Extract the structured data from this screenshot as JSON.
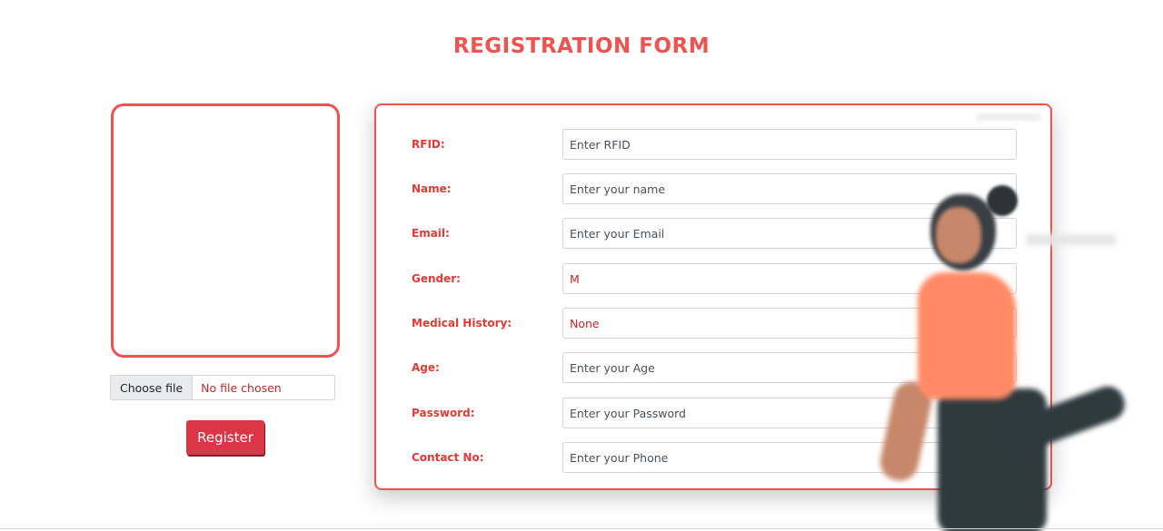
{
  "header": {
    "title": "REGISTRATION FORM"
  },
  "upload": {
    "choose_label": "Choose file",
    "status": "No file chosen"
  },
  "register_label": "Register",
  "form": {
    "rfid": {
      "label": "RFID:",
      "placeholder": "Enter RFID",
      "value": ""
    },
    "name": {
      "label": "Name:",
      "placeholder": "Enter your name",
      "value": ""
    },
    "email": {
      "label": "Email:",
      "placeholder": "Enter your Email",
      "value": ""
    },
    "gender": {
      "label": "Gender:",
      "placeholder": "",
      "value": "M"
    },
    "medical": {
      "label": "Medical History:",
      "placeholder": "",
      "value": "None"
    },
    "age": {
      "label": "Age:",
      "placeholder": "Enter your Age",
      "value": ""
    },
    "password": {
      "label": "Password:",
      "placeholder": "Enter your Password",
      "value": ""
    },
    "contact": {
      "label": "Contact No:",
      "placeholder": "Enter your Phone",
      "value": ""
    }
  },
  "colors": {
    "accent": "#ef5350",
    "button": "#dc3545",
    "label": "#e53935"
  }
}
